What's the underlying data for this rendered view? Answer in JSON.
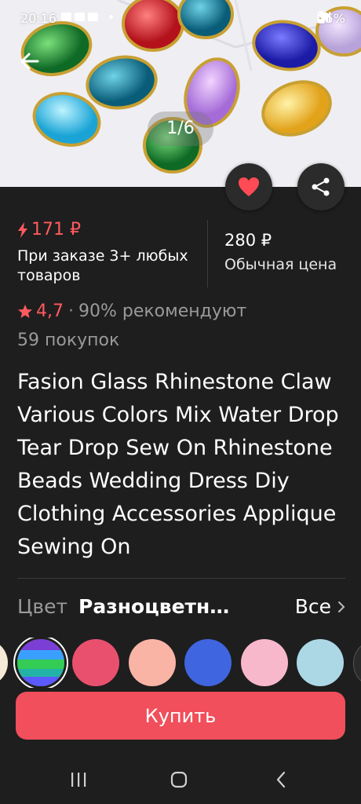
{
  "status_bar": {
    "time": "20:16",
    "battery": "25%"
  },
  "gallery": {
    "pager": "1/6"
  },
  "price": {
    "promo": "171 ₽",
    "promo_condition": "При заказе 3+ любых товаров",
    "regular": "280 ₽",
    "regular_label": "Обычная цена"
  },
  "rating": {
    "value": "4,7",
    "separator": "·",
    "recommend": "90% рекомендуют",
    "purchases": "59 покупок"
  },
  "product": {
    "title": "Fasion Glass Rhinestone Claw Various Colors Mix Water Drop Tear Drop Sew On Rhinestone Beads Wedding Dress Diy Clothing Accessories Applique Sewing On"
  },
  "color": {
    "label": "Цвет",
    "selected": "Разноцветн…",
    "all_label": "Все",
    "swatches": [
      "#f5ead6",
      "multicolor",
      "#e9506e",
      "#f9b4a6",
      "#3f66e0",
      "#f8b8cc",
      "#acd8e6"
    ]
  },
  "actions": {
    "buy_label": "Купить"
  },
  "icons": [
    "back-arrow-icon",
    "heart-icon",
    "share-icon",
    "lightning-icon",
    "star-icon",
    "chevron-right-icon",
    "recent-apps-icon",
    "home-icon",
    "back-icon"
  ],
  "colors": {
    "accent": "#f04f5b",
    "promo": "#ff5a5f",
    "background": "#1e1e1e"
  }
}
